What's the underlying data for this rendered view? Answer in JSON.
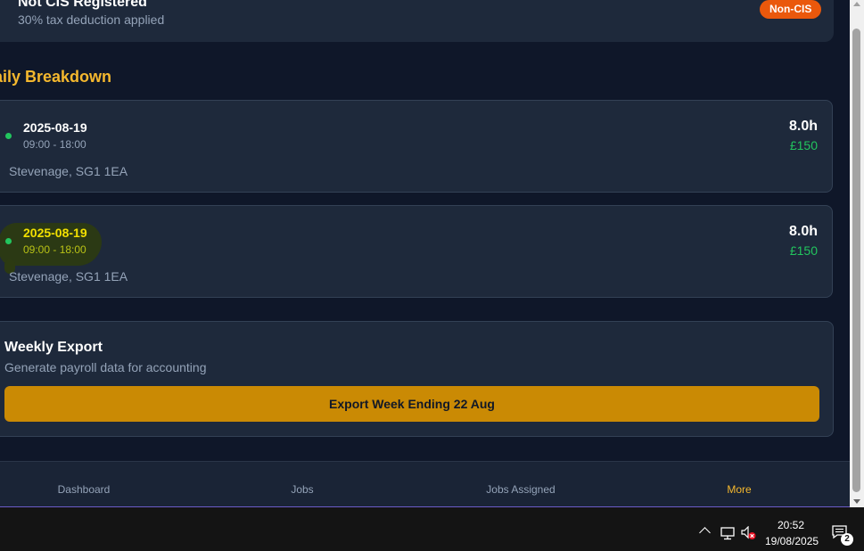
{
  "cis_card": {
    "title": "Not CIS Registered",
    "subtitle": "30% tax deduction applied",
    "badge": "Non-CIS"
  },
  "section_title": "aily Breakdown",
  "days": [
    {
      "date": "2025-08-19",
      "time": "09:00 - 18:00",
      "location": "Stevenage, SG1 1EA",
      "hours": "8.0h",
      "pay": "£150"
    },
    {
      "date": "2025-08-19",
      "time": "09:00 - 18:00",
      "location": "Stevenage, SG1 1EA",
      "hours": "8.0h",
      "pay": "£150"
    }
  ],
  "export": {
    "title": "Weekly Export",
    "subtitle": "Generate payroll data for accounting",
    "button_label": "Export Week Ending 22 Aug"
  },
  "nav": [
    {
      "label": "Dashboard"
    },
    {
      "label": "Jobs"
    },
    {
      "label": "Jobs Assigned"
    },
    {
      "label": "More",
      "active": true
    }
  ],
  "colors": {
    "accent": "#f5b82e",
    "badge": "#ea580c",
    "status_dot": "#22c55e",
    "export_button": "#ca8a04"
  },
  "taskbar": {
    "time": "20:52",
    "date": "19/08/2025",
    "notification_count": "2",
    "icons": [
      "chevron-up-icon",
      "network-icon",
      "volume-muted-icon",
      "notification-icon"
    ]
  }
}
